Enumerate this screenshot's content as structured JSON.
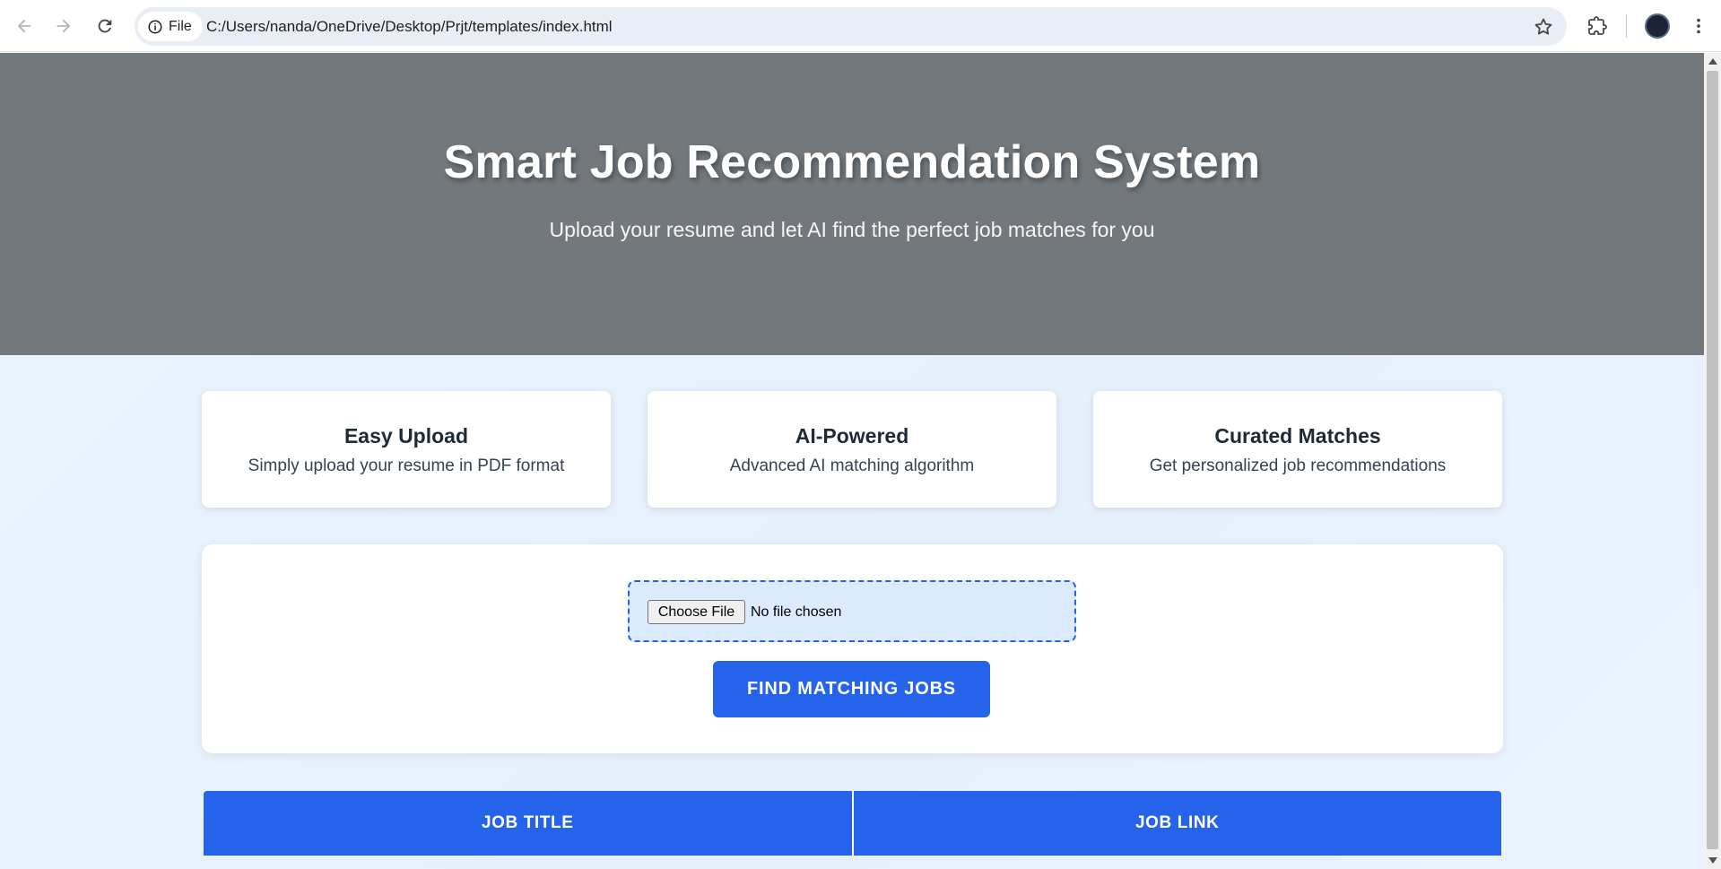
{
  "browser": {
    "chip_label": "File",
    "url": "C:/Users/nanda/OneDrive/Desktop/Prjt/templates/index.html"
  },
  "hero": {
    "title": "Smart Job Recommendation System",
    "subtitle": "Upload your resume and let AI find the perfect job matches for you"
  },
  "features": [
    {
      "title": "Easy Upload",
      "description": "Simply upload your resume in PDF format"
    },
    {
      "title": "AI-Powered",
      "description": "Advanced AI matching algorithm"
    },
    {
      "title": "Curated Matches",
      "description": "Get personalized job recommendations"
    }
  ],
  "upload": {
    "choose_label": "Choose File",
    "status": "No file chosen",
    "submit_label": "FIND MATCHING JOBS"
  },
  "results_table": {
    "columns": [
      "JOB TITLE",
      "JOB LINK"
    ]
  },
  "colors": {
    "hero_bg": "#73787d",
    "accent": "#2563eb",
    "page_bg": "#e8f4fd"
  },
  "icons": [
    "back-arrow-icon",
    "forward-arrow-icon",
    "reload-icon",
    "info-icon",
    "star-icon",
    "extensions-icon",
    "more-vert-icon"
  ]
}
